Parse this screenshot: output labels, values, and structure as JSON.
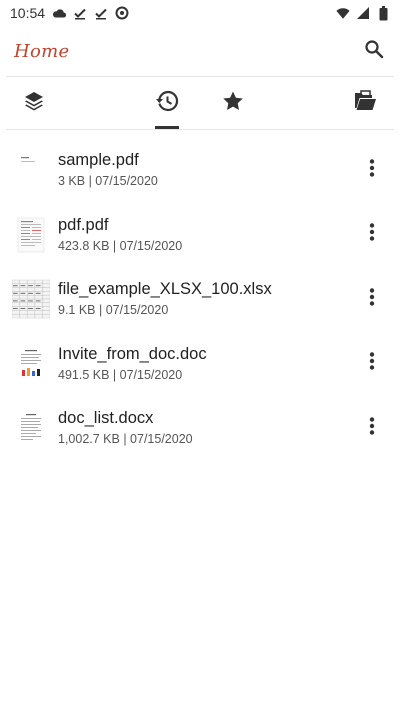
{
  "status_bar": {
    "time": "10:54",
    "left_icons": [
      "cloud-icon",
      "check-icon",
      "check-icon",
      "at-sign-icon"
    ],
    "right_icons": [
      "wifi-icon",
      "signal-icon",
      "battery-icon"
    ]
  },
  "app_bar": {
    "title": "Home",
    "title_color": "#c0442e",
    "search_icon": "search-icon"
  },
  "tabs": [
    {
      "name": "layers",
      "icon": "layers-icon",
      "selected": false
    },
    {
      "name": "recent",
      "icon": "history-icon",
      "selected": true
    },
    {
      "name": "favorites",
      "icon": "star-icon",
      "selected": false
    },
    {
      "name": "folders",
      "icon": "folder-open-icon",
      "selected": false
    }
  ],
  "files": [
    {
      "name": "sample.pdf",
      "meta": "3 KB | 07/15/2020",
      "thumb": "blank-doc-thumbnail"
    },
    {
      "name": "pdf.pdf",
      "meta": "423.8 KB | 07/15/2020",
      "thumb": "pdf-thumbnail"
    },
    {
      "name": "file_example_XLSX_100.xlsx",
      "meta": "9.1 KB | 07/15/2020",
      "thumb": "spreadsheet-thumbnail"
    },
    {
      "name": "Invite_from_doc.doc",
      "meta": "491.5 KB | 07/15/2020",
      "thumb": "doc-thumbnail"
    },
    {
      "name": "doc_list.docx",
      "meta": "1,002.7 KB | 07/15/2020",
      "thumb": "doc-thumbnail"
    }
  ]
}
